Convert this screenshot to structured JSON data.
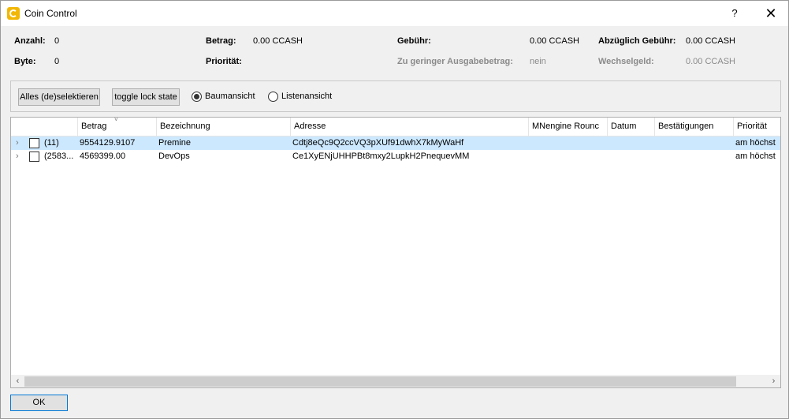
{
  "window": {
    "title": "Coin Control",
    "help_label": "?",
    "close_label": "✕"
  },
  "summary": {
    "anzahl_label": "Anzahl:",
    "anzahl_value": "0",
    "byte_label": "Byte:",
    "byte_value": "0",
    "betrag_label": "Betrag:",
    "betrag_value": "0.00 CCASH",
    "prioritaet_label": "Priorität:",
    "prioritaet_value": "",
    "gebuehr_label": "Gebühr:",
    "gebuehr_value": "0.00 CCASH",
    "geringer_label": "Zu geringer Ausgabebetrag:",
    "geringer_value": "nein",
    "abzueglich_label": "Abzüglich Gebühr:",
    "abzueglich_value": "0.00 CCASH",
    "wechsel_label": "Wechselgeld:",
    "wechsel_value": "0.00 CCASH"
  },
  "options": {
    "select_all_label": "Alles (de)selektieren",
    "toggle_lock_label": "toggle lock state",
    "tree_view_label": "Baumansicht",
    "list_view_label": "Listenansicht",
    "selected_view": "Baumansicht"
  },
  "table": {
    "columns": [
      "",
      "Betrag",
      "Bezeichnung",
      "Adresse",
      "MNengine Rounc",
      "Datum",
      "Bestätigungen",
      "Priorität"
    ],
    "sort_indicator": "˅",
    "rows": [
      {
        "count": "(11)",
        "amount": "9554129.9107",
        "label": "Premine",
        "address": "Cdtj8eQc9Q2ccVQ3pXUf91dwhX7kMyWaHf",
        "mnengine": "",
        "date": "",
        "confirmations": "",
        "priority": "am höchst",
        "selected": true
      },
      {
        "count": "(2583...",
        "amount": "4569399.00",
        "label": "DevOps",
        "address": "Ce1XyENjUHHPBt8mxy2LupkH2PnequevMM",
        "mnengine": "",
        "date": "",
        "confirmations": "",
        "priority": "am höchst",
        "selected": false
      }
    ]
  },
  "footer": {
    "ok_label": "OK"
  }
}
